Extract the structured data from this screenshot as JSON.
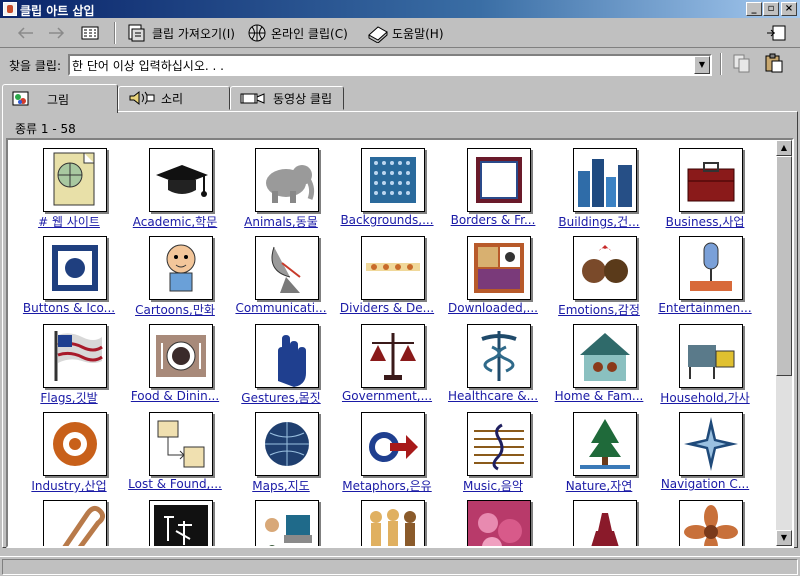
{
  "window": {
    "title": "클립 아트 삽입"
  },
  "toolbar": {
    "import_label": "클립 가져오기(I)",
    "online_label": "온라인 클립(C)",
    "help_label": "도움말(H)"
  },
  "search": {
    "label": "찾을 클립:",
    "value": "한 단어 이상 입력하십시오. . ."
  },
  "tabs": [
    {
      "label": "그림",
      "icon": "picture-icon",
      "active": true
    },
    {
      "label": "소리",
      "icon": "sound-icon",
      "active": false
    },
    {
      "label": "동영상 클립",
      "icon": "video-icon",
      "active": false
    }
  ],
  "category_count": "종류 1 - 58",
  "categories": [
    {
      "label": "# 웹 사이트",
      "icon": "globe-page-icon"
    },
    {
      "label": "Academic,학문",
      "icon": "graduation-cap-icon"
    },
    {
      "label": "Animals,동물",
      "icon": "elephant-icon"
    },
    {
      "label": "Backgrounds,...",
      "icon": "dot-grid-icon"
    },
    {
      "label": "Borders & Fr...",
      "icon": "frame-icon"
    },
    {
      "label": "Buildings,건...",
      "icon": "skyline-icon"
    },
    {
      "label": "Business,사업",
      "icon": "briefcase-icon"
    },
    {
      "label": "Buttons & Ico...",
      "icon": "button-icon"
    },
    {
      "label": "Cartoons,만화",
      "icon": "cartoon-kid-icon"
    },
    {
      "label": "Communicati...",
      "icon": "satellite-dish-icon"
    },
    {
      "label": "Dividers & De...",
      "icon": "divider-icon"
    },
    {
      "label": "Downloaded,...",
      "icon": "photo-collage-icon"
    },
    {
      "label": "Emotions,감정",
      "icon": "couple-heart-icon"
    },
    {
      "label": "Entertainmen...",
      "icon": "microphone-icon"
    },
    {
      "label": "Flags,깃발",
      "icon": "flag-icon"
    },
    {
      "label": "Food & Dinin...",
      "icon": "plate-icon"
    },
    {
      "label": "Gestures,몸짓",
      "icon": "hand-icon"
    },
    {
      "label": "Government,...",
      "icon": "scales-icon"
    },
    {
      "label": "Healthcare &...",
      "icon": "caduceus-icon"
    },
    {
      "label": "Home & Fam...",
      "icon": "house-family-icon"
    },
    {
      "label": "Household,가사",
      "icon": "appliance-icon"
    },
    {
      "label": "Industry,산업",
      "icon": "gear-icon"
    },
    {
      "label": "Lost & Found,...",
      "icon": "flowchart-icon"
    },
    {
      "label": "Maps,지도",
      "icon": "globe-icon"
    },
    {
      "label": "Metaphors,은유",
      "icon": "arrow-icon"
    },
    {
      "label": "Music,음악",
      "icon": "treble-clef-icon"
    },
    {
      "label": "Nature,자연",
      "icon": "tree-icon"
    },
    {
      "label": "Navigation C...",
      "icon": "compass-icon"
    },
    {
      "label": "",
      "icon": "paperclip-icon"
    },
    {
      "label": "",
      "icon": "chalkboard-icon"
    },
    {
      "label": "",
      "icon": "computer-user-icon"
    },
    {
      "label": "",
      "icon": "people-icon"
    },
    {
      "label": "",
      "icon": "flowers-photo-icon"
    },
    {
      "label": "",
      "icon": "eiffel-tower-icon"
    },
    {
      "label": "",
      "icon": "flower-icon"
    }
  ]
}
